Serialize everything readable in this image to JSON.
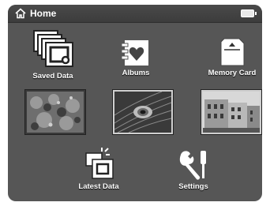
{
  "header": {
    "title": "Home",
    "home_icon": "home-icon",
    "battery_icon": "battery-icon"
  },
  "menu": [
    {
      "label": "Saved Data",
      "icon": "saved-data-icon"
    },
    {
      "label": "Albums",
      "icon": "albums-icon"
    },
    {
      "label": "Memory Card",
      "icon": "memory-card-icon"
    },
    {
      "label": "Latest Data",
      "icon": "latest-data-icon"
    },
    {
      "label": "Settings",
      "icon": "settings-icon"
    }
  ],
  "thumbnails": [
    {
      "subject": "plants",
      "selected": true
    },
    {
      "subject": "peacock feather",
      "selected": false
    },
    {
      "subject": "buildings",
      "selected": false
    }
  ]
}
